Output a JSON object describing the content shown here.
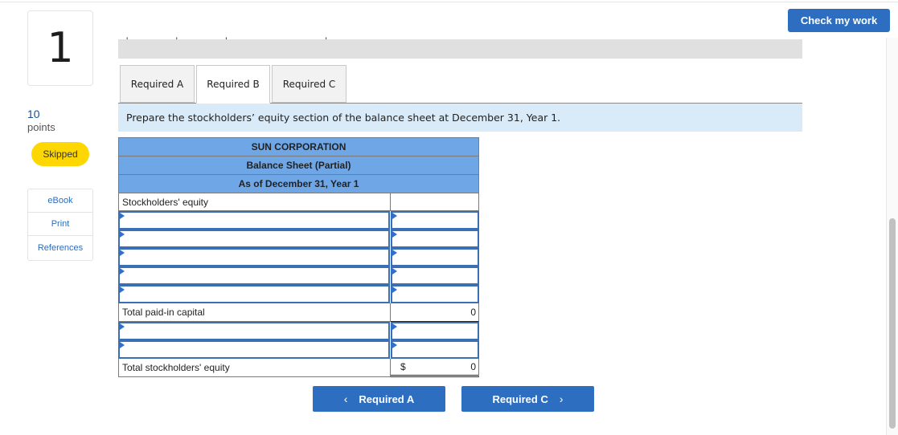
{
  "question": {
    "number": "1",
    "points_value": "10",
    "points_label": "points",
    "status": "Skipped"
  },
  "resources": [
    {
      "label": "eBook"
    },
    {
      "label": "Print"
    },
    {
      "label": "References"
    }
  ],
  "header": {
    "check_my_work": "Check my work",
    "cut_text": "' ' ' , '"
  },
  "tabs": [
    {
      "label": "Required A",
      "active": false
    },
    {
      "label": "Required B",
      "active": true
    },
    {
      "label": "Required C",
      "active": false
    }
  ],
  "instruction": "Prepare the stockholders’ equity section of the balance sheet at December 31, Year 1.",
  "sheet": {
    "company": "SUN CORPORATION",
    "title": "Balance Sheet (Partial)",
    "date": "As of December 31, Year 1",
    "section_label": "Stockholders' equity",
    "input_rows_group1": [
      {
        "label": "",
        "amount": ""
      },
      {
        "label": "",
        "amount": ""
      },
      {
        "label": "",
        "amount": ""
      },
      {
        "label": "",
        "amount": ""
      },
      {
        "label": "",
        "amount": ""
      }
    ],
    "total_paid_in": {
      "label": "Total paid-in capital",
      "amount": "0"
    },
    "input_rows_group2": [
      {
        "label": "",
        "amount": ""
      },
      {
        "label": "",
        "amount": ""
      }
    ],
    "total_se": {
      "label": "Total stockholders' equity",
      "currency": "$",
      "amount": "0"
    }
  },
  "navigation": {
    "prev_label": "Required A",
    "next_label": "Required C",
    "prev_chevron": "‹",
    "next_chevron": "›"
  }
}
